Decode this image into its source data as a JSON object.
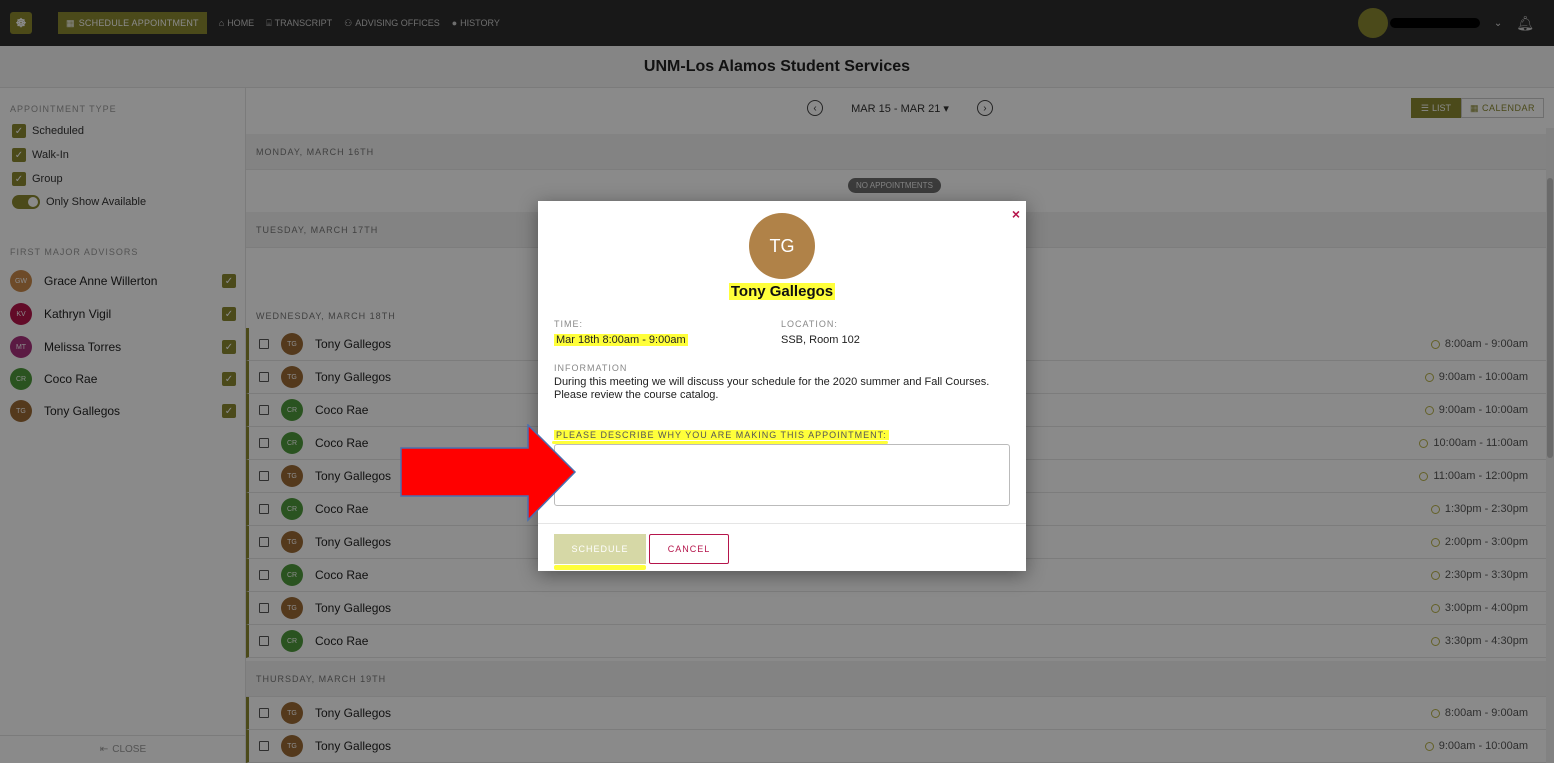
{
  "nav": {
    "logo": "☸",
    "active": "SCHEDULE APPOINTMENT",
    "links": [
      "HOME",
      "TRANSCRIPT",
      "ADVISING OFFICES",
      "HISTORY"
    ]
  },
  "header": {
    "title": "UNM-Los Alamos Student Services"
  },
  "sidebar": {
    "appointment_type_heading": "APPOINTMENT TYPE",
    "types": [
      "Scheduled",
      "Walk-In",
      "Group"
    ],
    "only_available": "Only Show Available",
    "advisors_heading": "FIRST MAJOR ADVISORS",
    "advisors": [
      {
        "initials": "GW",
        "name": "Grace Anne Willerton",
        "color": "#c98a4b"
      },
      {
        "initials": "KV",
        "name": "Kathryn Vigil",
        "color": "#b5154b"
      },
      {
        "initials": "MT",
        "name": "Melissa Torres",
        "color": "#a8307d"
      },
      {
        "initials": "CR",
        "name": "Coco Rae",
        "color": "#4e9a3b"
      },
      {
        "initials": "TG",
        "name": "Tony Gallegos",
        "color": "#9b6a35"
      }
    ],
    "close": "CLOSE"
  },
  "week": {
    "range": "MAR 15 - MAR 21 ▾",
    "prev": "‹",
    "next": "›"
  },
  "view": {
    "list": "LIST",
    "calendar": "CALENDAR"
  },
  "days": {
    "monday": "MONDAY, MARCH 16TH",
    "monday_empty": "NO APPOINTMENTS",
    "tuesday": "TUESDAY, MARCH 17TH",
    "wednesday": "WEDNESDAY, MARCH 18TH",
    "thursday": "THURSDAY, MARCH 19TH"
  },
  "wednesday_rows": [
    {
      "initials": "TG",
      "name": "Tony Gallegos",
      "time": "8:00am - 9:00am"
    },
    {
      "initials": "TG",
      "name": "Tony Gallegos",
      "time": "9:00am - 10:00am"
    },
    {
      "initials": "CR",
      "name": "Coco Rae",
      "time": "9:00am - 10:00am"
    },
    {
      "initials": "CR",
      "name": "Coco Rae",
      "time": "10:00am - 11:00am"
    },
    {
      "initials": "TG",
      "name": "Tony Gallegos",
      "time": "11:00am - 12:00pm"
    },
    {
      "initials": "CR",
      "name": "Coco Rae",
      "time": "1:30pm - 2:30pm"
    },
    {
      "initials": "TG",
      "name": "Tony Gallegos",
      "time": "2:00pm - 3:00pm"
    },
    {
      "initials": "CR",
      "name": "Coco Rae",
      "time": "2:30pm - 3:30pm"
    },
    {
      "initials": "TG",
      "name": "Tony Gallegos",
      "time": "3:00pm - 4:00pm"
    },
    {
      "initials": "CR",
      "name": "Coco Rae",
      "time": "3:30pm - 4:30pm"
    }
  ],
  "thursday_rows": [
    {
      "initials": "TG",
      "name": "Tony Gallegos",
      "time": "8:00am - 9:00am"
    },
    {
      "initials": "TG",
      "name": "Tony Gallegos",
      "time": "9:00am - 10:00am"
    }
  ],
  "modal": {
    "close": "×",
    "initials": "TG",
    "name": "Tony Gallegos",
    "time_label": "TIME:",
    "time_value": "Mar 18th 8:00am - 9:00am",
    "location_label": "LOCATION:",
    "location_value": "SSB, Room 102",
    "info_label": "INFORMATION",
    "info_text": "During this meeting we will discuss your schedule for the 2020 summer and Fall Courses. Please review the course catalog.",
    "describe_label": "PLEASE DESCRIBE WHY YOU ARE MAKING THIS APPOINTMENT:",
    "reason_placeholder": "",
    "schedule": "SCHEDULE",
    "cancel": "CANCEL"
  },
  "colors": {
    "accent": "#8b8a30",
    "highlight": "#ffff3a",
    "cancel": "#b5154b",
    "annotation_arrow": "#ff0000",
    "tg": "#9b6a35",
    "cr": "#4e9a3b"
  }
}
